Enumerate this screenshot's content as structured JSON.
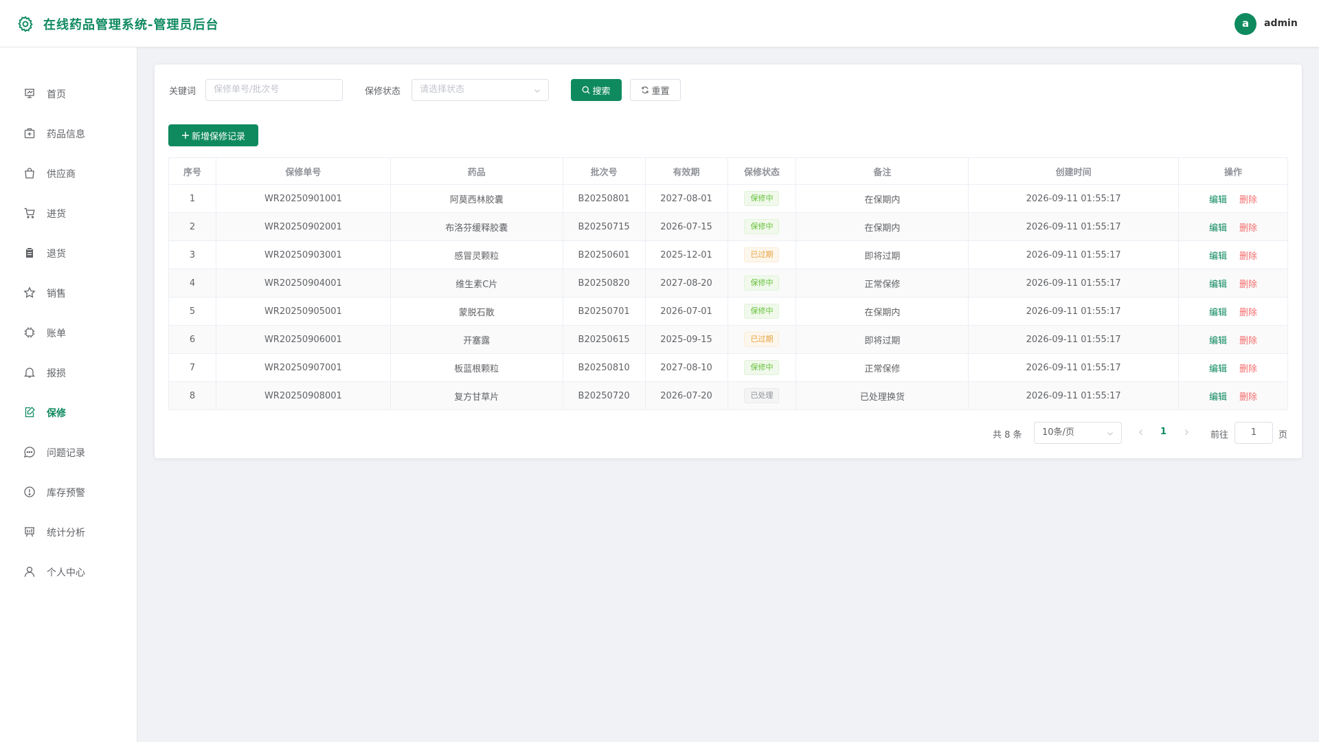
{
  "app": {
    "title": "在线药品管理系统-管理员后台",
    "accent": "#0f8a5f"
  },
  "user": {
    "avatar_letter": "a",
    "name": "admin"
  },
  "sidebar": {
    "items": [
      {
        "label": "首页",
        "icon": "presentation-icon",
        "active": false
      },
      {
        "label": "药品信息",
        "icon": "medicine-box-icon",
        "active": false
      },
      {
        "label": "供应商",
        "icon": "shopping-bag-icon",
        "active": false
      },
      {
        "label": "进货",
        "icon": "cart-icon",
        "active": false
      },
      {
        "label": "退货",
        "icon": "clipboard-icon",
        "active": false
      },
      {
        "label": "销售",
        "icon": "star-icon",
        "active": false
      },
      {
        "label": "账单",
        "icon": "cpu-icon",
        "active": false
      },
      {
        "label": "报损",
        "icon": "bell-icon",
        "active": false
      },
      {
        "label": "保修",
        "icon": "edit-document-icon",
        "active": true
      },
      {
        "label": "问题记录",
        "icon": "chat-dots-icon",
        "active": false
      },
      {
        "label": "库存预警",
        "icon": "warning-icon",
        "active": false
      },
      {
        "label": "统计分析",
        "icon": "board-icon",
        "active": false
      },
      {
        "label": "个人中心",
        "icon": "user-icon",
        "active": false
      }
    ]
  },
  "filters": {
    "keyword_label": "关键词",
    "keyword_placeholder": "保修单号/批次号",
    "status_label": "保修状态",
    "status_placeholder": "请选择状态",
    "search_label": "搜索",
    "reset_label": "重置",
    "add_label": "新增保修记录"
  },
  "table": {
    "columns": [
      "序号",
      "保修单号",
      "药品",
      "批次号",
      "有效期",
      "保修状态",
      "备注",
      "创建时间",
      "操作"
    ],
    "edit_label": "编辑",
    "delete_label": "删除",
    "rows": [
      {
        "idx": "1",
        "code": "WR20250901001",
        "drug": "阿莫西林胶囊",
        "batch": "B20250801",
        "expiry": "2027-08-01",
        "status": "保修中",
        "status_type": "success",
        "note": "在保期内",
        "created": "2026-09-11 01:55:17"
      },
      {
        "idx": "2",
        "code": "WR20250902001",
        "drug": "布洛芬缓释胶囊",
        "batch": "B20250715",
        "expiry": "2026-07-15",
        "status": "保修中",
        "status_type": "success",
        "note": "在保期内",
        "created": "2026-09-11 01:55:17"
      },
      {
        "idx": "3",
        "code": "WR20250903001",
        "drug": "感冒灵颗粒",
        "batch": "B20250601",
        "expiry": "2025-12-01",
        "status": "已过期",
        "status_type": "warning",
        "note": "即将过期",
        "created": "2026-09-11 01:55:17"
      },
      {
        "idx": "4",
        "code": "WR20250904001",
        "drug": "维生素C片",
        "batch": "B20250820",
        "expiry": "2027-08-20",
        "status": "保修中",
        "status_type": "success",
        "note": "正常保修",
        "created": "2026-09-11 01:55:17"
      },
      {
        "idx": "5",
        "code": "WR20250905001",
        "drug": "蒙脱石散",
        "batch": "B20250701",
        "expiry": "2026-07-01",
        "status": "保修中",
        "status_type": "success",
        "note": "在保期内",
        "created": "2026-09-11 01:55:17"
      },
      {
        "idx": "6",
        "code": "WR20250906001",
        "drug": "开塞露",
        "batch": "B20250615",
        "expiry": "2025-09-15",
        "status": "已过期",
        "status_type": "warning",
        "note": "即将过期",
        "created": "2026-09-11 01:55:17"
      },
      {
        "idx": "7",
        "code": "WR20250907001",
        "drug": "板蓝根颗粒",
        "batch": "B20250810",
        "expiry": "2027-08-10",
        "status": "保修中",
        "status_type": "success",
        "note": "正常保修",
        "created": "2026-09-11 01:55:17"
      },
      {
        "idx": "8",
        "code": "WR20250908001",
        "drug": "复方甘草片",
        "batch": "B20250720",
        "expiry": "2026-07-20",
        "status": "已处理",
        "status_type": "info",
        "note": "已处理换货",
        "created": "2026-09-11 01:55:17"
      }
    ]
  },
  "pagination": {
    "total_text": "共 8 条",
    "page_size": "10条/页",
    "current_page": "1",
    "goto_label": "前往",
    "goto_value": "1",
    "page_suffix": "页"
  }
}
